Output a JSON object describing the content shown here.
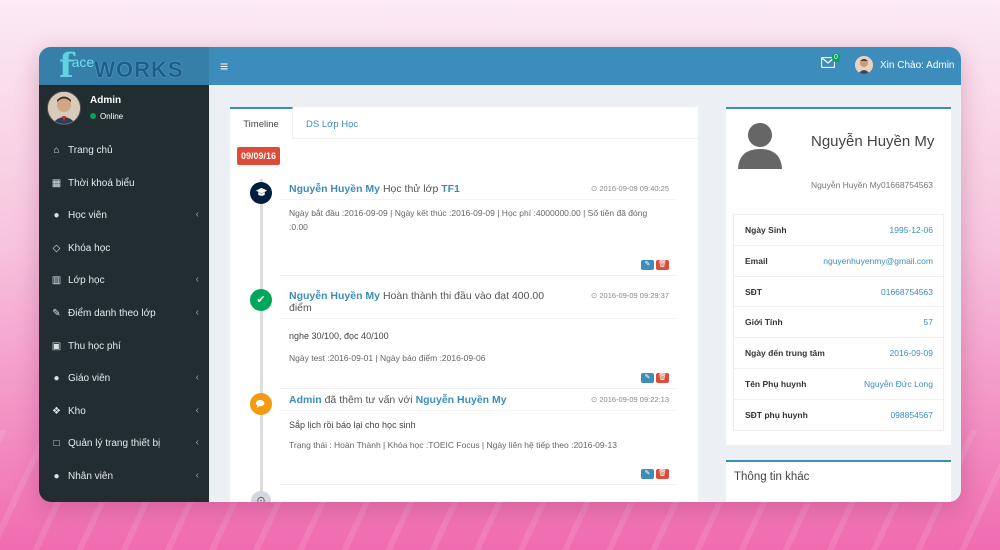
{
  "header": {
    "logo": {
      "f": "f",
      "ace": "ace",
      "works": "WORKS"
    },
    "menu_toggle_icon": "hamburger-icon",
    "mail_badge": "0",
    "greeting": "Xin Chào: Admin"
  },
  "sidebar": {
    "user": {
      "name": "Admin",
      "status": "Online"
    },
    "items": [
      {
        "label": "Trang chủ",
        "icon": "home-icon",
        "glyph": "⌂",
        "has_children": false
      },
      {
        "label": "Thời khoá biểu",
        "icon": "calendar-icon",
        "glyph": "▦",
        "has_children": false
      },
      {
        "label": "Học viên",
        "icon": "users-icon",
        "glyph": "●",
        "has_children": true
      },
      {
        "label": "Khóa học",
        "icon": "diamond-icon",
        "glyph": "◇",
        "has_children": false
      },
      {
        "label": "Lớp học",
        "icon": "institution-icon",
        "glyph": "▥",
        "has_children": true
      },
      {
        "label": "Điểm danh theo lớp",
        "icon": "edit-icon",
        "glyph": "✎",
        "has_children": true
      },
      {
        "label": "Thu học phí",
        "icon": "money-icon",
        "glyph": "▣",
        "has_children": false
      },
      {
        "label": "Giáo viên",
        "icon": "user-icon",
        "glyph": "●",
        "has_children": true
      },
      {
        "label": "Kho",
        "icon": "cubes-icon",
        "glyph": "❖",
        "has_children": true
      },
      {
        "label": "Quản lý trang thiết bị",
        "icon": "square-icon",
        "glyph": "□",
        "has_children": true
      },
      {
        "label": "Nhân viên",
        "icon": "users-icon",
        "glyph": "●",
        "has_children": true
      }
    ],
    "chevron": "‹"
  },
  "tabs": [
    {
      "label": "Timeline",
      "active": true
    },
    {
      "label": "DS Lớp Học",
      "active": false
    }
  ],
  "timeline": {
    "date": "09/09/16",
    "items": [
      {
        "icon": "graduation-cap-icon",
        "color": "#001f3f",
        "actor": "Nguyễn Huyền My",
        "action": "Học thử lớp",
        "target": "TF1",
        "time": "⊙ 2016-09-09 09:40:25",
        "lines": [
          "Ngày bắt đầu :2016-09-09 | Ngày kết thúc :2016-09-09 | Học phí :4000000.00 | Số tiền đã đóng :0.00"
        ]
      },
      {
        "icon": "check-icon",
        "color": "#00a65a",
        "actor": "Nguyễn Huyền My",
        "action": "Hoàn thành thi đầu vào đạt 400.00 điểm",
        "target": "",
        "time": "⊙ 2016-09-09 09:29:37",
        "lines": [
          "nghe 30/100, đọc 40/100",
          "Ngày test :2016-09-01 | Ngày báo điểm :2016-09-06"
        ]
      },
      {
        "icon": "comments-icon",
        "color": "#f39c12",
        "actor": "Admin",
        "action": "đã thêm tư vấn với",
        "target": "Nguyễn Huyền My",
        "time": "⊙ 2016-09-09 09:22:13",
        "lines": [
          "Sắp lịch rồi báo lại cho học sinh",
          "Trạng thái : Hoàn Thành | Khóa học :TOEIC Focus | Ngày liên hệ tiếp theo :2016-09-13"
        ]
      }
    ],
    "end_icon": "clock-icon"
  },
  "profile": {
    "name": "Nguyễn Huyền My",
    "sub": "Nguyễn Huyền My01668754563",
    "rows": [
      {
        "k": "Ngày Sinh",
        "v": "1995-12-06"
      },
      {
        "k": "Email",
        "v": "nguyenhuyenmy@gmail.com"
      },
      {
        "k": "SĐT",
        "v": "01668754563"
      },
      {
        "k": "Giới Tính",
        "v": "57"
      },
      {
        "k": "Ngày đến trung tâm",
        "v": "2016-09-09"
      },
      {
        "k": "Tên Phụ huynh",
        "v": "Nguyễn Đức Long"
      },
      {
        "k": "SĐT phụ huynh",
        "v": "098854567"
      }
    ]
  },
  "other_info": {
    "title": "Thông tin khác"
  },
  "colors": {
    "primary": "#3c8dbc",
    "sidebar": "#222d32",
    "danger": "#dd4b39",
    "success": "#00a65a",
    "warning": "#f39c12",
    "navy": "#001f3f"
  }
}
